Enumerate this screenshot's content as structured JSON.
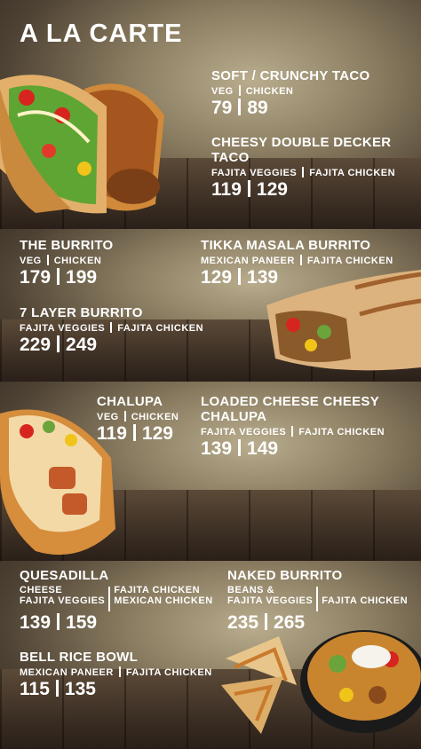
{
  "menu_title": "A LA CARTE",
  "sections": {
    "tacos": {
      "soft_crunchy": {
        "name": "SOFT / CRUNCHY TACO",
        "opt1": "VEG",
        "opt2": "CHICKEN",
        "p1": "79",
        "p2": "89"
      },
      "cheesy_double": {
        "name": "CHEESY DOUBLE DECKER TACO",
        "opt1": "FAJITA VEGGIES",
        "opt2": "FAJITA CHICKEN",
        "p1": "119",
        "p2": "129"
      }
    },
    "burritos": {
      "the_burrito": {
        "name": "THE BURRITO",
        "opt1": "VEG",
        "opt2": "CHICKEN",
        "p1": "179",
        "p2": "199"
      },
      "tikka": {
        "name": "TIKKA MASALA BURRITO",
        "opt1": "MEXICAN PANEER",
        "opt2": "FAJITA CHICKEN",
        "p1": "129",
        "p2": "139"
      },
      "seven_layer": {
        "name": "7 LAYER BURRITO",
        "opt1": "FAJITA VEGGIES",
        "opt2": "FAJITA CHICKEN",
        "p1": "229",
        "p2": "249"
      }
    },
    "chalupas": {
      "chalupa": {
        "name": "CHALUPA",
        "opt1": "VEG",
        "opt2": "CHICKEN",
        "p1": "119",
        "p2": "129"
      },
      "loaded": {
        "name": "LOADED CHEESE CHEESY CHALUPA",
        "opt1": "FAJITA VEGGIES",
        "opt2": "FAJITA CHICKEN",
        "p1": "139",
        "p2": "149"
      }
    },
    "others": {
      "quesadilla": {
        "name": "QUESADILLA",
        "opt1a": "CHEESE",
        "opt1b": "FAJITA VEGGIES",
        "opt2a": "FAJITA CHICKEN",
        "opt2b": "MEXICAN CHICKEN",
        "p1": "139",
        "p2": "159"
      },
      "naked": {
        "name": "NAKED BURRITO",
        "opt1a": "BEANS &",
        "opt1b": "FAJITA VEGGIES",
        "opt2": "FAJITA CHICKEN",
        "p1": "235",
        "p2": "265"
      },
      "rice_bowl": {
        "name": "BELL RICE BOWL",
        "opt1": "MEXICAN PANEER",
        "opt2": "FAJITA CHICKEN",
        "p1": "115",
        "p2": "135"
      }
    }
  }
}
